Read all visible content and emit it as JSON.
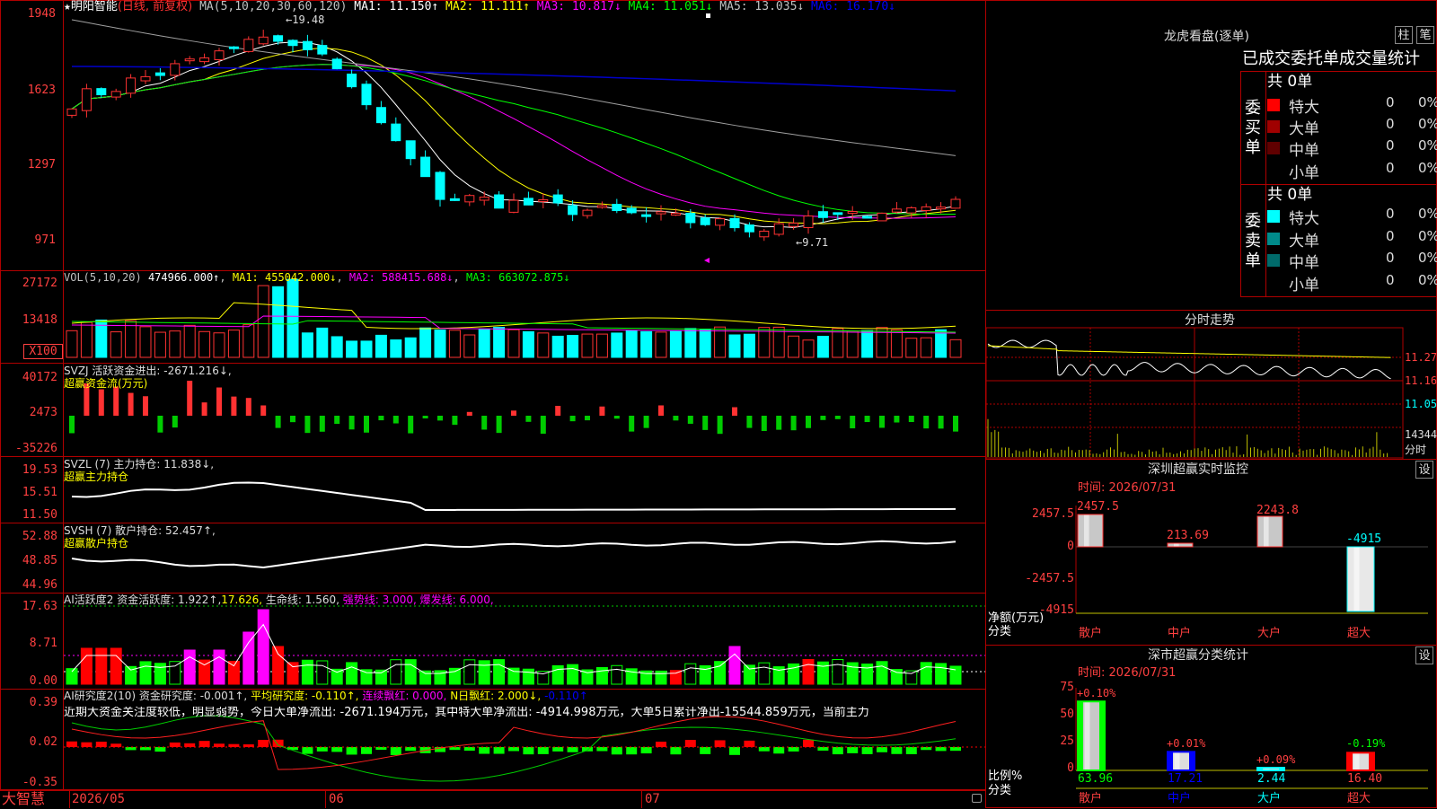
{
  "stock": {
    "star": "★",
    "name": "明阳智能",
    "period": "(日线, 前复权)"
  },
  "ma_header": {
    "params": "MA(5,10,20,30,60,120)",
    "items": [
      {
        "label": "MA1: 11.150↑",
        "color": "#ffffff"
      },
      {
        "label": "MA2: 11.111↑",
        "color": "#ffff00"
      },
      {
        "label": "MA3: 10.817↓",
        "color": "#ff00ff"
      },
      {
        "label": "MA4: 11.051↓",
        "color": "#00ff00"
      },
      {
        "label": "MA5: 13.035↓",
        "color": "#c0c0c0"
      },
      {
        "label": "MA6: 16.170↓",
        "color": "#0000ff"
      }
    ]
  },
  "price_axis": [
    "1948",
    "1623",
    "1297",
    "971"
  ],
  "price_high": "19.48",
  "price_low": "9.71",
  "vol": {
    "params": "VOL(5,10,20)",
    "value": "474966.000↑",
    "ma1": "MA1: 455042.000↓",
    "ma2": "MA2: 588415.688↓",
    "ma3": "MA3: 663072.875↓",
    "axis": [
      "27172",
      "13418"
    ],
    "unit": "X100"
  },
  "svzj": {
    "line1": "SVZJ  活跃资金进出: -2671.216↓,",
    "line2": "超赢资金流(万元)",
    "axis": [
      "40172",
      "2473",
      "-35226"
    ]
  },
  "svzl": {
    "line1": "SVZL (7) 主力持仓: 11.838↓,",
    "line2": "超赢主力持仓",
    "axis": [
      "19.53",
      "15.51",
      "11.50"
    ]
  },
  "svsh": {
    "line1": "SVSH (7) 散户持仓: 52.457↑,",
    "line2": "超赢散户持仓",
    "axis": [
      "52.88",
      "48.85",
      "44.96"
    ]
  },
  "ai_active": {
    "title": "AI活跃度2 资金活跃度: 1.922↑,",
    "v2": "17.626,",
    "life": "生命线: 1.560,",
    "strong": "强势线: 3.000,",
    "burst": "爆发线: 6.000,",
    "axis": [
      "17.63",
      "8.71",
      "0.00"
    ]
  },
  "ai_research": {
    "title": "AI研究度2(10) 资金研究度: -0.001↑,",
    "avg": "平均研究度: -0.110↑,",
    "red": "连续飘红: 0.000,",
    "nday": "N日飘红: 2.000↓,",
    "last": "-0.110↑",
    "note": "近期大资金关注度较低，明显弱势，今日大单净流出: -2671.194万元，其中特大单净流出: -4914.998万元，大单5日累计净出-15544.859万元，当前主力",
    "axis": [
      "0.39",
      "0.02",
      "-0.35"
    ]
  },
  "dates": [
    "2026/05",
    "06",
    "07"
  ],
  "brand": "大智慧",
  "lhb": {
    "title": "龙虎看盘(逐单)",
    "btn_zhu": "柱",
    "btn_bi": "笔",
    "tabs": [
      "已成交",
      "委托单",
      "成交量统计"
    ],
    "buy": {
      "side": "委买单",
      "total": "共 0单",
      "rows": [
        {
          "label": "特大",
          "count": "0",
          "pct": "0%",
          "color": "#ff0000"
        },
        {
          "label": "大单",
          "count": "0",
          "pct": "0%",
          "color": "#a00000"
        },
        {
          "label": "中单",
          "count": "0",
          "pct": "0%",
          "color": "#600000"
        },
        {
          "label": "小单",
          "count": "0",
          "pct": "0%",
          "color": "#000000"
        }
      ]
    },
    "sell": {
      "side": "委卖单",
      "total": "共 0单",
      "rows": [
        {
          "label": "特大",
          "count": "0",
          "pct": "0%",
          "color": "#00ffff"
        },
        {
          "label": "大单",
          "count": "0",
          "pct": "0%",
          "color": "#008b8b"
        },
        {
          "label": "中单",
          "count": "0",
          "pct": "0%",
          "color": "#006b6b"
        },
        {
          "label": "小单",
          "count": "0",
          "pct": "0%",
          "color": "#000000"
        }
      ]
    }
  },
  "intraday": {
    "title": "分时走势",
    "axis": [
      "11.27",
      "11.16",
      "11.05"
    ],
    "vol": "14344",
    "vol_label": "分时"
  },
  "monitor": {
    "title": "深圳超赢实时监控",
    "set": "设",
    "time": "时间: 2026/07/31",
    "axis": [
      "2457.5",
      "0",
      "-2457.5",
      "-4915"
    ],
    "ylabel": "净额(万元)",
    "xlabel": "分类",
    "cats": [
      "散户",
      "中户",
      "大户",
      "超大"
    ],
    "values": [
      "2457.5",
      "213.69",
      "2243.8",
      "-4915"
    ]
  },
  "stats": {
    "title": "深市超赢分类统计",
    "set": "设",
    "time": "时间: 2026/07/31",
    "axis": [
      "75",
      "50",
      "25",
      "0"
    ],
    "ylabel": "比例%",
    "xlabel": "分类",
    "cats": [
      "散户",
      "中户",
      "大户",
      "超大"
    ],
    "changes": [
      "+0.10%",
      "+0.01%",
      "+0.09%",
      "-0.19%"
    ],
    "values": [
      "63.96",
      "17.21",
      "2.44",
      "16.40"
    ]
  },
  "colors": {
    "up": "#ff3232",
    "down": "#00ffff",
    "green": "#00ff00",
    "magenta": "#ff00ff",
    "yellow": "#ffff00",
    "frame": "#b00000"
  }
}
